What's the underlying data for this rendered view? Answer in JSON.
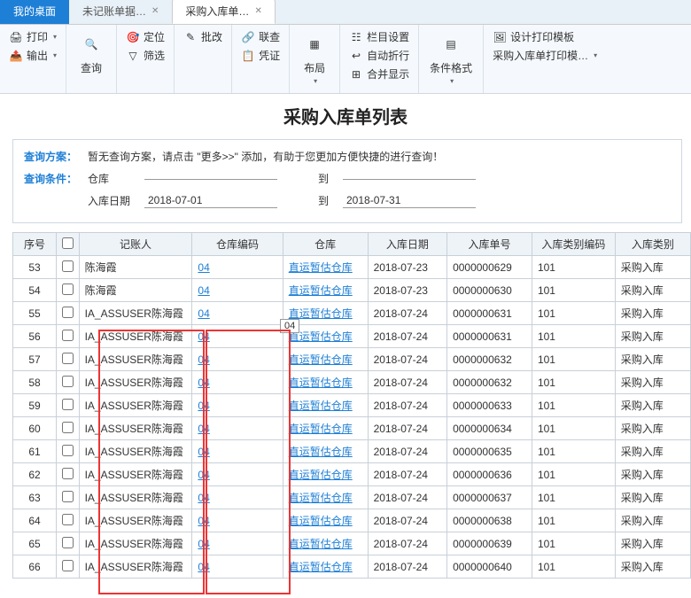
{
  "tabs": {
    "t0": "我的桌面",
    "t1": "未记账单据…",
    "t2": "采购入库单…"
  },
  "toolbar": {
    "print": "打印",
    "output": "输出",
    "query": "查询",
    "locate": "定位",
    "filter": "筛选",
    "batch": "批改",
    "linked": "联查",
    "voucher": "凭证",
    "layout": "布局",
    "colset": "栏目设置",
    "autowrap": "自动折行",
    "merge": "合并显示",
    "condfmt": "条件格式",
    "prntpl": "设计打印模板",
    "prntpl2": "采购入库单打印模…"
  },
  "title": "采购入库单列表",
  "query": {
    "plan_label": "查询方案：",
    "plan_text": "暂无查询方案，请点击 \"更多>>\" 添加，有助于您更加方便快捷的进行查询！",
    "cond_label": "查询条件：",
    "warehouse_label": "仓库",
    "to_label": "到",
    "date_label": "入库日期",
    "date_from": "2018-07-01",
    "date_to": "2018-07-31"
  },
  "columns": {
    "seq": "序号",
    "user": "记账人",
    "whcode": "仓库编码",
    "wh": "仓库",
    "date": "入库日期",
    "no": "入库单号",
    "typecode": "入库类别编码",
    "type": "入库类别"
  },
  "link_text": "直运暂估仓库",
  "rows": [
    {
      "seq": "53",
      "user": "陈海霞",
      "whcode": "04",
      "date": "2018-07-23",
      "no": "0000000629",
      "typecode": "101",
      "type": "采购入库"
    },
    {
      "seq": "54",
      "user": "陈海霞",
      "whcode": "04",
      "date": "2018-07-23",
      "no": "0000000630",
      "typecode": "101",
      "type": "采购入库"
    },
    {
      "seq": "55",
      "user": "IA_ASSUSER陈海霞",
      "whcode": "04",
      "date": "2018-07-24",
      "no": "0000000631",
      "typecode": "101",
      "type": "采购入库"
    },
    {
      "seq": "56",
      "user": "IA_ASSUSER陈海霞",
      "whcode": "04",
      "date": "2018-07-24",
      "no": "0000000631",
      "typecode": "101",
      "type": "采购入库"
    },
    {
      "seq": "57",
      "user": "IA_ASSUSER陈海霞",
      "whcode": "04",
      "date": "2018-07-24",
      "no": "0000000632",
      "typecode": "101",
      "type": "采购入库"
    },
    {
      "seq": "58",
      "user": "IA_ASSUSER陈海霞",
      "whcode": "04",
      "date": "2018-07-24",
      "no": "0000000632",
      "typecode": "101",
      "type": "采购入库"
    },
    {
      "seq": "59",
      "user": "IA_ASSUSER陈海霞",
      "whcode": "04",
      "date": "2018-07-24",
      "no": "0000000633",
      "typecode": "101",
      "type": "采购入库"
    },
    {
      "seq": "60",
      "user": "IA_ASSUSER陈海霞",
      "whcode": "04",
      "date": "2018-07-24",
      "no": "0000000634",
      "typecode": "101",
      "type": "采购入库"
    },
    {
      "seq": "61",
      "user": "IA_ASSUSER陈海霞",
      "whcode": "04",
      "date": "2018-07-24",
      "no": "0000000635",
      "typecode": "101",
      "type": "采购入库"
    },
    {
      "seq": "62",
      "user": "IA_ASSUSER陈海霞",
      "whcode": "04",
      "date": "2018-07-24",
      "no": "0000000636",
      "typecode": "101",
      "type": "采购入库"
    },
    {
      "seq": "63",
      "user": "IA_ASSUSER陈海霞",
      "whcode": "04",
      "date": "2018-07-24",
      "no": "0000000637",
      "typecode": "101",
      "type": "采购入库"
    },
    {
      "seq": "64",
      "user": "IA_ASSUSER陈海霞",
      "whcode": "04",
      "date": "2018-07-24",
      "no": "0000000638",
      "typecode": "101",
      "type": "采购入库"
    },
    {
      "seq": "65",
      "user": "IA_ASSUSER陈海霞",
      "whcode": "04",
      "date": "2018-07-24",
      "no": "0000000639",
      "typecode": "101",
      "type": "采购入库"
    },
    {
      "seq": "66",
      "user": "IA_ASSUSER陈海霞",
      "whcode": "04",
      "date": "2018-07-24",
      "no": "0000000640",
      "typecode": "101",
      "type": "采购入库"
    }
  ],
  "float04": "04"
}
